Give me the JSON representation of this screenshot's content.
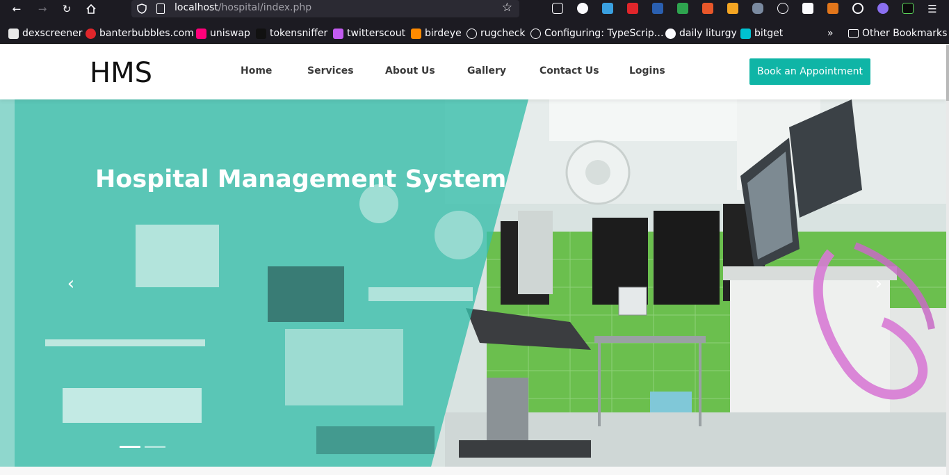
{
  "browser": {
    "url_host": "localhost",
    "url_path": "/hospital/index.php",
    "bookmarks": [
      {
        "label": "dexscreener",
        "icon": "dexscreener-icon",
        "color": "#e8e8e8"
      },
      {
        "label": "banterbubbles.com",
        "icon": "banterbubbles-icon",
        "color": "#e0262b"
      },
      {
        "label": "uniswap",
        "icon": "uniswap-icon",
        "color": "#ff007a"
      },
      {
        "label": "tokensniffer",
        "icon": "tokensniffer-icon",
        "color": "#111111"
      },
      {
        "label": "twitterscout",
        "icon": "twitterscout-icon",
        "color": "#c35cf0"
      },
      {
        "label": "birdeye",
        "icon": "birdeye-icon",
        "color": "#ff8a00"
      },
      {
        "label": "rugcheck",
        "icon": "globe-icon",
        "color": "#fbfbfe"
      },
      {
        "label": "Configuring: TypeScrip…",
        "icon": "globe-icon",
        "color": "#fbfbfe"
      },
      {
        "label": "daily liturgy",
        "icon": "daily-liturgy-icon",
        "color": "#fbfbfe"
      },
      {
        "label": "bitget",
        "icon": "bitget-icon",
        "color": "#00c2d1"
      }
    ],
    "other_bookmarks": "Other Bookmarks"
  },
  "site": {
    "logo": "HMS",
    "nav": [
      "Home",
      "Services",
      "About Us",
      "Gallery",
      "Contact Us",
      "Logins"
    ],
    "cta_label": "Book an Appointment",
    "accent": "#0fb5a6"
  },
  "hero": {
    "title": "Hospital Management System",
    "prev_glyph": "‹",
    "next_glyph": "›",
    "slide_count": 2,
    "active_slide": 1
  }
}
